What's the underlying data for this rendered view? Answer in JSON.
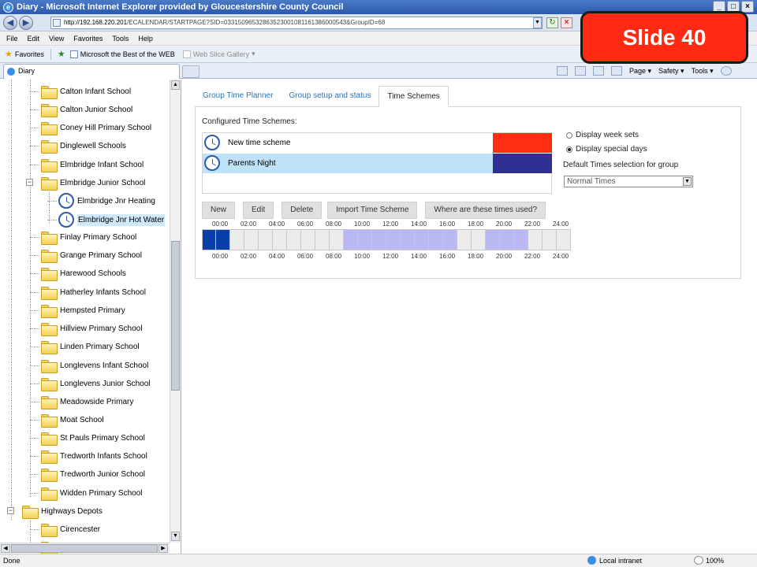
{
  "window": {
    "title": "Diary - Microsoft Internet Explorer provided by Gloucestershire County Council",
    "minimize": "_",
    "maximize": "□",
    "close": "×"
  },
  "address": {
    "host": "http://192.168.220.201",
    "path": "/ECALENDAR/STARTPAGE?SID=03315096532863523001081161386000543&GroupID=68"
  },
  "menu": [
    "File",
    "Edit",
    "View",
    "Favorites",
    "Tools",
    "Help"
  ],
  "favorites": {
    "label": "Favorites",
    "items": [
      "Microsoft the Best of the WEB",
      "Web Slice Gallery"
    ]
  },
  "browser_tab": {
    "label": "Diary"
  },
  "command_bar": {
    "page": "Page ▾",
    "safety": "Safety ▾",
    "tools": "Tools ▾"
  },
  "tree": {
    "schools": [
      "Calton Infant School",
      "Calton Junior School",
      "Coney Hill Primary School",
      "Dinglewell Schools",
      "Elmbridge Infant School",
      "Elmbridge Junior School"
    ],
    "children": [
      "Elmbridge Jnr Heating",
      "Elmbridge Jnr Hot Water"
    ],
    "schools_after": [
      "Finlay Primary School",
      "Grange Primary School",
      "Harewood Schools",
      "Hatherley Infants School",
      "Hempsted Primary",
      "Hillview Primary School",
      "Linden Primary School",
      "Longlevens Infant School",
      "Longlevens Junior School",
      "Meadowside Primary",
      "Moat School",
      "St Pauls Primary School",
      "Tredworth Infants School",
      "Tredworth Junior School",
      "Widden Primary School"
    ],
    "group": "Highways Depots",
    "group_children": [
      "Cirencester"
    ]
  },
  "content": {
    "tabs": [
      "Group Time Planner",
      "Group setup and status",
      "Time Schemes"
    ],
    "active_tab": 2,
    "configured_label": "Configured Time Schemes:",
    "schemes": [
      {
        "name": "New time scheme",
        "color": "#ff2d12"
      },
      {
        "name": "Parents Night",
        "color": "#2e3192"
      }
    ],
    "radio_week": "Display week sets",
    "radio_special": "Display special days",
    "default_label": "Default Times selection for group",
    "default_value": "Normal Times",
    "buttons": [
      "New",
      "Edit",
      "Delete",
      "Import Time Scheme",
      "Where are these times used?"
    ],
    "time_labels": [
      "00:00",
      "02:00",
      "04:00",
      "06:00",
      "08:00",
      "10:00",
      "12:00",
      "14:00",
      "16:00",
      "18:00",
      "20:00",
      "22:00",
      "24:00"
    ],
    "timeline_colors": {
      "dark": "#0b3fa8",
      "light": "#b9b8f2",
      "empty": "#ececec"
    }
  },
  "status": {
    "text": "Done",
    "zone": "Local intranet",
    "zoom": "100%"
  },
  "slide": {
    "label": "Slide 40"
  }
}
